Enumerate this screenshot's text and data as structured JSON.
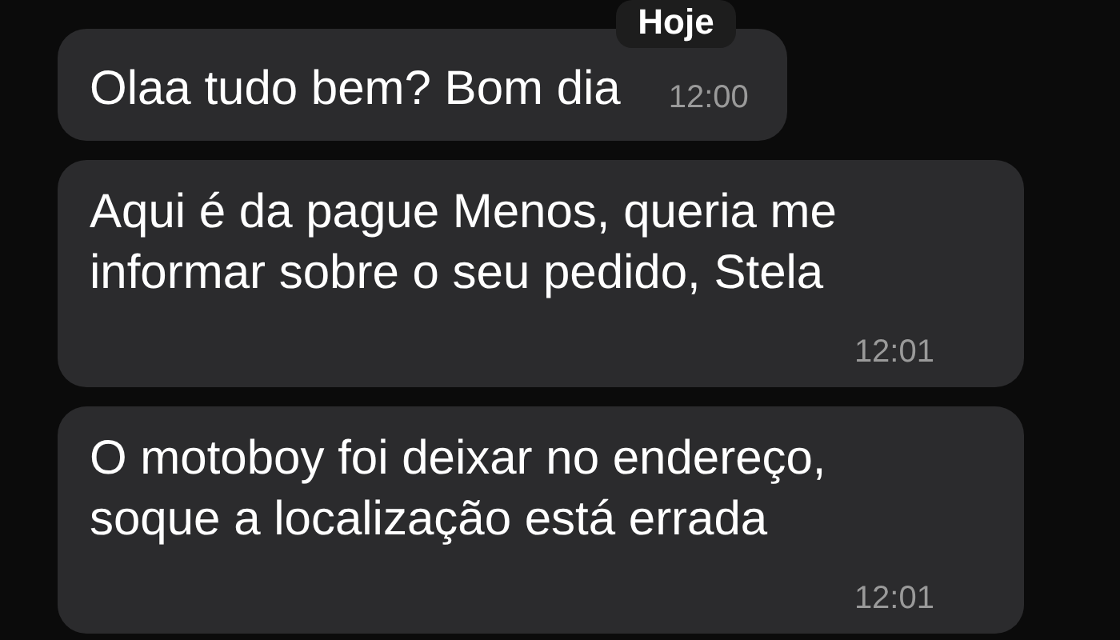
{
  "date_label": "Hoje",
  "messages": [
    {
      "text": "Olaa tudo bem? Bom dia",
      "time": "12:00",
      "kind": "inline"
    },
    {
      "text": "Aqui é da pague Menos, queria me informar sobre o seu pedido, Stela",
      "time": "12:01",
      "kind": "block"
    },
    {
      "text": "O motoboy foi deixar no endereço, soque a localização está errada",
      "time": "12:01",
      "kind": "block"
    }
  ]
}
